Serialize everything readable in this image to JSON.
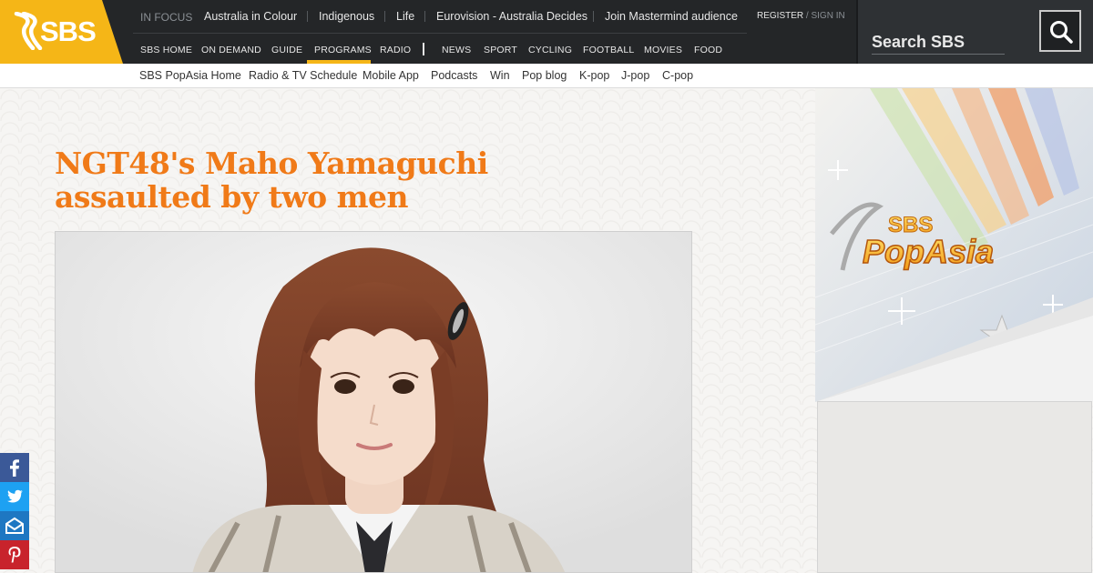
{
  "brand": {
    "logo_text": "SBS",
    "color": "#f5b617"
  },
  "in_focus": {
    "label": "IN FOCUS",
    "links": [
      "Australia in Colour",
      "Indigenous",
      "Life",
      "Eurovision - Australia Decides",
      "Join Mastermind audience"
    ]
  },
  "account": {
    "register": "REGISTER",
    "slash": "/",
    "sign_in": "SIGN IN"
  },
  "main_nav": {
    "items": [
      "SBS HOME",
      "ON DEMAND",
      "GUIDE",
      "PROGRAMS",
      "RADIO",
      "NEWS",
      "SPORT",
      "CYCLING",
      "FOOTBALL",
      "MOVIES",
      "FOOD"
    ],
    "active": "PROGRAMS"
  },
  "search": {
    "label": "Search SBS",
    "icon": "search-icon"
  },
  "sub_nav": {
    "items": [
      "SBS PopAsia Home",
      "Radio & TV Schedule",
      "Mobile App",
      "Podcasts",
      "Win",
      "Pop blog",
      "K-pop",
      "J-pop",
      "C-pop"
    ]
  },
  "article": {
    "title_line1": "NGT48's Maho Yamaguchi",
    "title_line2": "assaulted by two men",
    "title_color": "#f07a18"
  },
  "banner": {
    "brand": "SBS",
    "name": "PopAsia"
  },
  "share": [
    {
      "icon": "facebook-icon",
      "color": "#3b5998"
    },
    {
      "icon": "twitter-icon",
      "color": "#1da1f2"
    },
    {
      "icon": "email-icon",
      "color": "#1e77c2"
    },
    {
      "icon": "pinterest-icon",
      "color": "#c8232c"
    }
  ]
}
